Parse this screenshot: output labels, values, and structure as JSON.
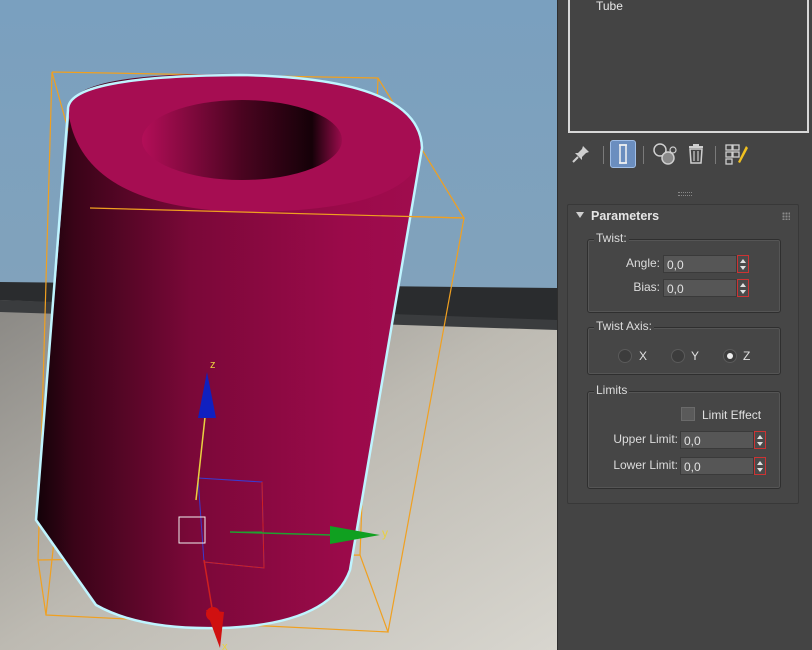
{
  "modifier_stack": {
    "items": [
      "Tube"
    ]
  },
  "toolbar": {
    "buttons": [
      "pin-stack-icon",
      "show-end-result-icon",
      "make-unique-icon",
      "remove-modifier-icon",
      "configure-modifier-sets-icon"
    ]
  },
  "rollout": {
    "title": "Parameters",
    "twist": {
      "label": "Twist:",
      "angle_label": "Angle:",
      "angle_value": "0,0",
      "bias_label": "Bias:",
      "bias_value": "0,0"
    },
    "twist_axis": {
      "label": "Twist Axis:",
      "options": [
        "X",
        "Y",
        "Z"
      ],
      "selected": "Z"
    },
    "limits": {
      "label": "Limits",
      "limit_effect_label": "Limit Effect",
      "limit_effect_checked": false,
      "upper_label": "Upper Limit:",
      "upper_value": "0,0",
      "lower_label": "Lower Limit:",
      "lower_value": "0,0"
    }
  },
  "viewport": {
    "gizmo_labels": {
      "z": "z",
      "y": "y",
      "x": "x"
    },
    "colors": {
      "sky": "#7a9cb8",
      "object": "#9b0a4a",
      "bbox": "#f0a020",
      "selection": "#bff4ff",
      "axis_x": "#d01010",
      "axis_y": "#10a020",
      "axis_z": "#1020c0"
    }
  }
}
